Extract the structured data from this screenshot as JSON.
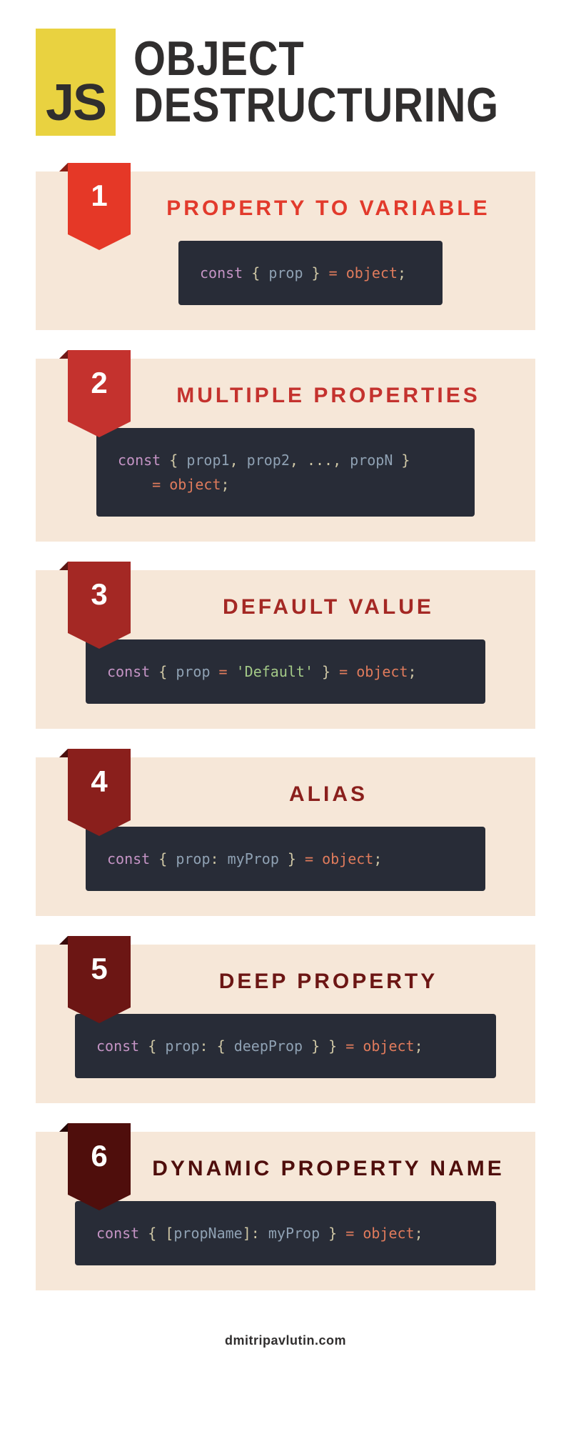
{
  "logo_text": "JS",
  "title_line1": "OBJECT",
  "title_line2": "DESTRUCTURING",
  "sections": [
    {
      "num": "1",
      "title": "PROPERTY TO VARIABLE",
      "code_tokens": [
        {
          "t": "const ",
          "c": "kw"
        },
        {
          "t": "{ ",
          "c": "punct"
        },
        {
          "t": "prop",
          "c": "prop"
        },
        {
          "t": " }",
          "c": "punct"
        },
        {
          "t": " = ",
          "c": "op"
        },
        {
          "t": "object",
          "c": "obj"
        },
        {
          "t": ";",
          "c": "punct"
        }
      ]
    },
    {
      "num": "2",
      "title": "MULTIPLE PROPERTIES",
      "code_tokens": [
        {
          "t": "const ",
          "c": "kw"
        },
        {
          "t": "{ ",
          "c": "punct"
        },
        {
          "t": "prop1",
          "c": "prop"
        },
        {
          "t": ", ",
          "c": "punct"
        },
        {
          "t": "prop2",
          "c": "prop"
        },
        {
          "t": ", ..., ",
          "c": "punct"
        },
        {
          "t": "propN",
          "c": "prop"
        },
        {
          "t": " }",
          "c": "punct"
        },
        {
          "t": "\n    = ",
          "c": "op"
        },
        {
          "t": "object",
          "c": "obj"
        },
        {
          "t": ";",
          "c": "punct"
        }
      ]
    },
    {
      "num": "3",
      "title": "DEFAULT VALUE",
      "code_tokens": [
        {
          "t": "const ",
          "c": "kw"
        },
        {
          "t": "{ ",
          "c": "punct"
        },
        {
          "t": "prop",
          "c": "prop"
        },
        {
          "t": " = ",
          "c": "op"
        },
        {
          "t": "'Default'",
          "c": "str"
        },
        {
          "t": " }",
          "c": "punct"
        },
        {
          "t": " = ",
          "c": "op"
        },
        {
          "t": "object",
          "c": "obj"
        },
        {
          "t": ";",
          "c": "punct"
        }
      ]
    },
    {
      "num": "4",
      "title": "ALIAS",
      "code_tokens": [
        {
          "t": "const ",
          "c": "kw"
        },
        {
          "t": "{ ",
          "c": "punct"
        },
        {
          "t": "prop",
          "c": "prop"
        },
        {
          "t": ": ",
          "c": "punct"
        },
        {
          "t": "myProp",
          "c": "prop"
        },
        {
          "t": " }",
          "c": "punct"
        },
        {
          "t": " = ",
          "c": "op"
        },
        {
          "t": "object",
          "c": "obj"
        },
        {
          "t": ";",
          "c": "punct"
        }
      ]
    },
    {
      "num": "5",
      "title": "DEEP PROPERTY",
      "code_tokens": [
        {
          "t": "const ",
          "c": "kw"
        },
        {
          "t": "{ ",
          "c": "punct"
        },
        {
          "t": "prop",
          "c": "prop"
        },
        {
          "t": ": ",
          "c": "punct"
        },
        {
          "t": "{ ",
          "c": "punct"
        },
        {
          "t": "deepProp",
          "c": "prop"
        },
        {
          "t": " }",
          "c": "punct"
        },
        {
          "t": " }",
          "c": "punct"
        },
        {
          "t": " = ",
          "c": "op"
        },
        {
          "t": "object",
          "c": "obj"
        },
        {
          "t": ";",
          "c": "punct"
        }
      ]
    },
    {
      "num": "6",
      "title": "DYNAMIC PROPERTY NAME",
      "code_tokens": [
        {
          "t": "const ",
          "c": "kw"
        },
        {
          "t": "{ ",
          "c": "punct"
        },
        {
          "t": "[",
          "c": "punct"
        },
        {
          "t": "propName",
          "c": "prop"
        },
        {
          "t": "]",
          "c": "punct"
        },
        {
          "t": ": ",
          "c": "punct"
        },
        {
          "t": "myProp",
          "c": "prop"
        },
        {
          "t": " }",
          "c": "punct"
        },
        {
          "t": " = ",
          "c": "op"
        },
        {
          "t": "object",
          "c": "obj"
        },
        {
          "t": ";",
          "c": "punct"
        }
      ]
    }
  ],
  "footer": "dmitripavlutin.com"
}
